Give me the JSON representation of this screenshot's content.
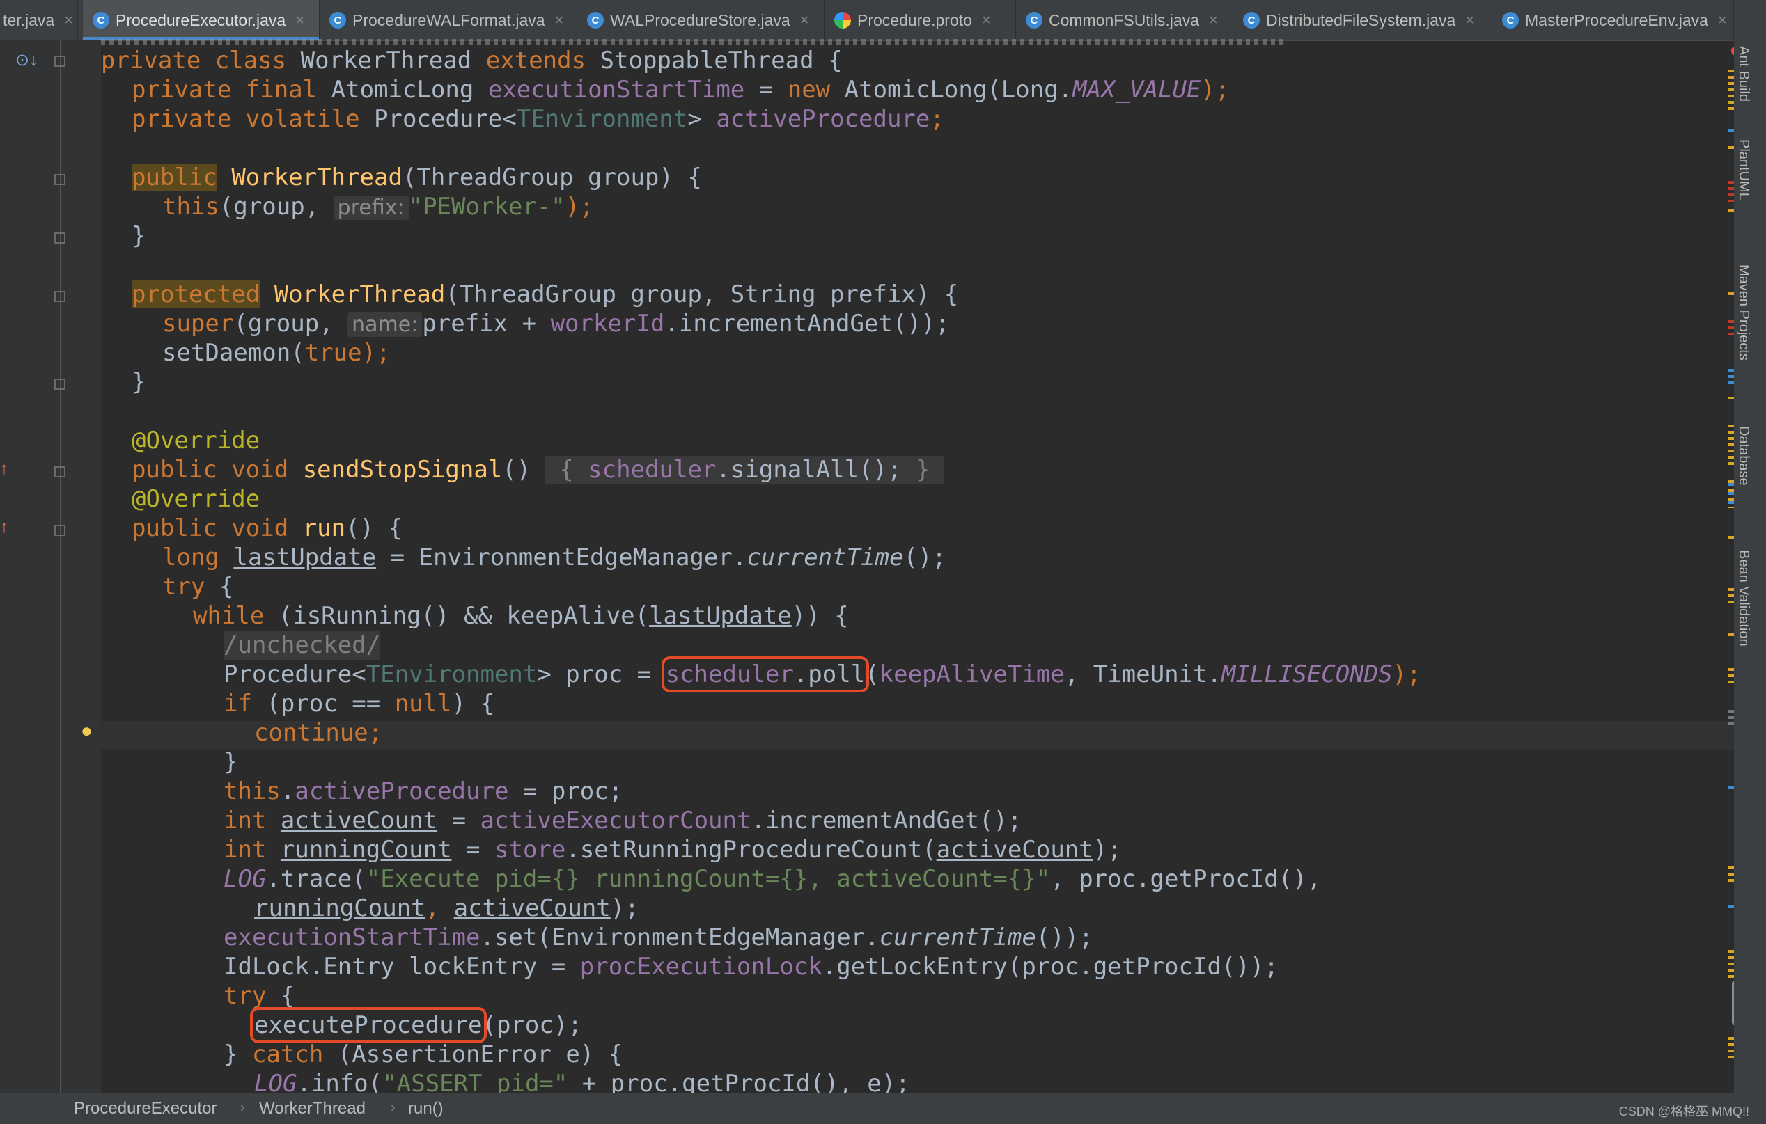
{
  "tabs": [
    {
      "label": "ter.java",
      "active": false
    },
    {
      "label": "ProcedureExecutor.java",
      "active": true
    },
    {
      "label": "ProcedureWALFormat.java",
      "active": false
    },
    {
      "label": "WALProcedureStore.java",
      "active": false
    },
    {
      "label": "Procedure.proto",
      "active": false
    },
    {
      "label": "CommonFSUtils.java",
      "active": false
    },
    {
      "label": "DistributedFileSystem.java",
      "active": false
    },
    {
      "label": "MasterProcedureEnv.java",
      "active": false
    }
  ],
  "tool_windows": [
    "Ant Build",
    "PlantUML",
    "Maven Projects",
    "Database",
    "Bean Validation"
  ],
  "breadcrumbs": [
    "ProcedureExecutor",
    "WorkerThread",
    "run()"
  ],
  "watermark": "CSDN @格格巫 MMQ!!",
  "code": {
    "l1": [
      "private",
      "class",
      "WorkerThread",
      "extends",
      "StoppableThread",
      "{"
    ],
    "l2": [
      "private",
      "final",
      "AtomicLong",
      "executionStartTime",
      "=",
      "new",
      "AtomicLong(Long.",
      "MAX_VALUE",
      ");"
    ],
    "l3": [
      "private",
      "volatile",
      "Procedure<",
      "TEnvironment",
      ">",
      "activeProcedure",
      ";"
    ],
    "l5": [
      "public",
      "WorkerThread",
      "(ThreadGroup group) {"
    ],
    "l6": [
      "this",
      "(group,",
      "prefix:",
      "\"PEWorker-\"",
      ");"
    ],
    "l7": "}",
    "l9": [
      "protected",
      "WorkerThread",
      "(ThreadGroup group, String prefix) {"
    ],
    "l10": [
      "super",
      "(group,",
      "name:",
      "prefix +",
      "workerId",
      ".incrementAndGet());"
    ],
    "l11": [
      "setDaemon(",
      "true",
      ");"
    ],
    "l12": "}",
    "l14": "@Override",
    "l15": [
      "public",
      "void",
      "sendStopSignal",
      "()",
      "{",
      "scheduler",
      ".signalAll();",
      "}"
    ],
    "l16": "@Override",
    "l17": [
      "public",
      "void",
      "run",
      "() {"
    ],
    "l18": [
      "long",
      "lastUpdate",
      "= EnvironmentEdgeManager.",
      "currentTime",
      "();"
    ],
    "l19": [
      "try",
      "{"
    ],
    "l20": [
      "while",
      "(isRunning() && keepAlive(",
      "lastUpdate",
      ")) {"
    ],
    "l21": "/unchecked/",
    "l22": [
      "Procedure<",
      "TEnvironment",
      "> proc =",
      "scheduler",
      ".poll",
      "(",
      "keepAliveTime",
      ", TimeUnit.",
      "MILLISECONDS",
      ");"
    ],
    "l23": [
      "if",
      "(proc ==",
      "null",
      ") {"
    ],
    "l24": [
      "continue",
      ";"
    ],
    "l25": "}",
    "l26": [
      "this",
      ".",
      "activeProcedure",
      "= proc;"
    ],
    "l27": [
      "int",
      "activeCount",
      "=",
      "activeExecutorCount",
      ".incrementAndGet();"
    ],
    "l28": [
      "int",
      "runningCount",
      "=",
      "store",
      ".setRunningProcedureCount(",
      "activeCount",
      ");"
    ],
    "l29": [
      "LOG",
      ".trace(",
      "\"Execute pid={} runningCount={}, activeCount={}\"",
      ", proc.getProcId(),"
    ],
    "l30": [
      "runningCount",
      ",",
      "activeCount",
      ");"
    ],
    "l31": [
      "executionStartTime",
      ".set(EnvironmentEdgeManager.",
      "currentTime",
      "());"
    ],
    "l32": [
      "IdLock.Entry lockEntry =",
      "procExecutionLock",
      ".getLockEntry(proc.getProcId());"
    ],
    "l33": [
      "try",
      "{"
    ],
    "l34": [
      "executeProcedure",
      "(proc);"
    ],
    "l35": [
      "}",
      "catch",
      "(AssertionError e) {"
    ],
    "l36": [
      "LOG",
      ".info(",
      "\"ASSERT pid=\"",
      "+ proc.getProcId(), e);"
    ]
  }
}
